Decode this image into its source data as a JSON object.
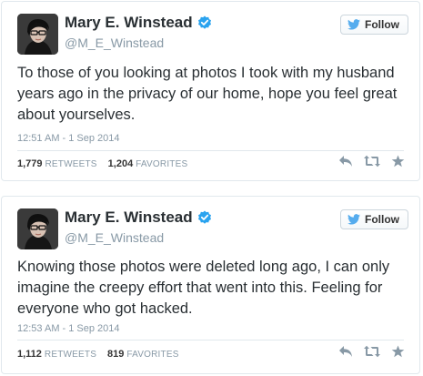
{
  "colors": {
    "text": "#292f33",
    "muted": "#8899a6",
    "twitter_blue": "#55acee",
    "verified": "#2aa3ef",
    "action_icon": "#8899a6"
  },
  "tweets": [
    {
      "author_name": "Mary E. Winstead",
      "handle": "@M_E_Winstead",
      "verified_icon": "verified-badge-icon",
      "follow_label": "Follow",
      "text": "To those of you looking at photos I took with my husband years ago in the privacy of our home, hope you feel great about yourselves.",
      "timestamp": "12:51 AM - 1 Sep 2014",
      "retweets_count": "1,779",
      "retweets_label": "RETWEETS",
      "favorites_count": "1,204",
      "favorites_label": "FAVORITES"
    },
    {
      "author_name": "Mary E. Winstead",
      "handle": "@M_E_Winstead",
      "verified_icon": "verified-badge-icon",
      "follow_label": "Follow",
      "text": "Knowing those photos were deleted long ago, I can only imagine the creepy effort that went into this. Feeling for everyone who got hacked.",
      "timestamp": "12:53 AM - 1 Sep 2014",
      "retweets_count": "1,112",
      "retweets_label": "RETWEETS",
      "favorites_count": "819",
      "favorites_label": "FAVORITES"
    }
  ]
}
